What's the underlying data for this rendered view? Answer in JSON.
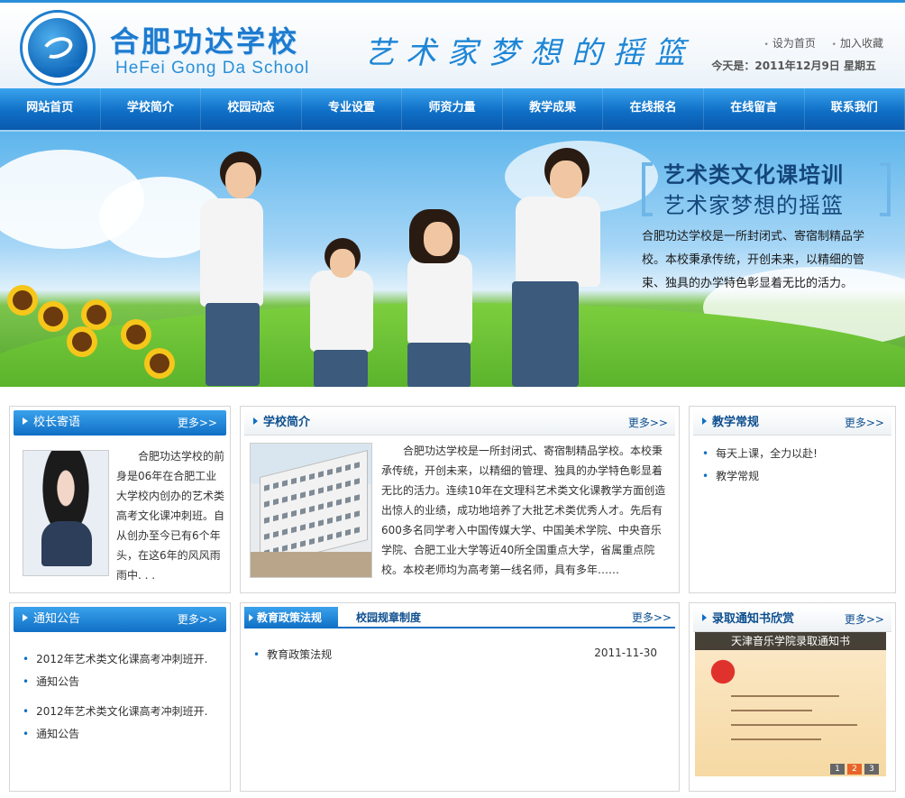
{
  "header": {
    "logo_text": "合肥功达学校",
    "logo_ring_text": "Gong Da School",
    "title_cn": "合肥功达学校",
    "title_en": "HeFei Gong Da School",
    "slogan": "艺术家梦想的摇篮",
    "links": [
      "设为首页",
      "加入收藏"
    ],
    "today": "今天是：2011年12月9日  星期五"
  },
  "nav": [
    "网站首页",
    "学校简介",
    "校园动态",
    "专业设置",
    "师资力量",
    "教学成果",
    "在线报名",
    "在线留言",
    "联系我们"
  ],
  "banner": {
    "title": "艺术类文化课培训",
    "subtitle": "艺术家梦想的摇篮",
    "desc": "合肥功达学校是一所封闭式、寄宿制精品学校。本校秉承传统，开创未来，以精细的管束、独具的办学特色彰显着无比的活力。"
  },
  "principal": {
    "title": "校长寄语",
    "more": "更多>>",
    "text": "合肥功达学校的前身是06年在合肥工业大学校内创办的艺术类高考文化课冲刺班。自从创办至今已有6个年头，在这6年的风风雨雨中. . ."
  },
  "intro": {
    "title": "学校简介",
    "more": "更多>>",
    "text": "合肥功达学校是一所封闭式、寄宿制精品学校。本校秉承传统，开创未来，以精细的管理、独具的办学特色彰显着无比的活力。连续10年在文理科艺术类文化课教学方面创造出惊人的业绩，成功地培养了大批艺术类优秀人才。先后有600多名同学考入中国传媒大学、中国美术学院、中央音乐学院、合肥工业大学等近40所全国重点大学，省属重点院校。本校老师均为高考第一线名师，具有多年……"
  },
  "teaching": {
    "title": "教学常规",
    "more": "更多>>",
    "items": [
      "每天上课，全力以赴!",
      "教学常规"
    ]
  },
  "notice": {
    "title": "通知公告",
    "more": "更多>>",
    "items": [
      "2012年艺术类文化课高考冲刺班开.",
      "通知公告",
      "2012年艺术类文化课高考冲刺班开.",
      "通知公告"
    ]
  },
  "policy": {
    "tab_active": "教育政策法规",
    "tab_other": "校园规章制度",
    "more": "更多>>",
    "rows": [
      {
        "label": "教育政策法规",
        "date": "2011-11-30"
      }
    ]
  },
  "letters": {
    "title": "录取通知书欣赏",
    "more": "更多>>",
    "caption": "天津音乐学院录取通知书",
    "pages": [
      "1",
      "2",
      "3"
    ],
    "active_page": "2"
  },
  "colors": {
    "brand": "#0f6fc5",
    "accent": "#e8652a"
  }
}
